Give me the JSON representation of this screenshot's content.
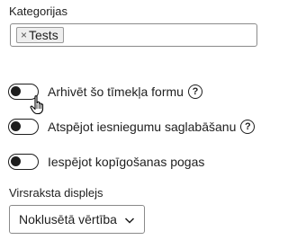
{
  "categories": {
    "label": "Kategorijas",
    "tags": [
      "Tests"
    ],
    "remove_symbol": "×"
  },
  "toggles": [
    {
      "label": "Arhivēt šo tīmekļa formu",
      "checked": false,
      "has_help": true
    },
    {
      "label": "Atspējot iesniegumu saglabāšanu",
      "checked": false,
      "has_help": true
    },
    {
      "label": "Iespējot kopīgošanas pogas",
      "checked": false,
      "has_help": false
    }
  ],
  "help_symbol": "?",
  "header_display": {
    "label": "Virsraksta displejs",
    "selected": "Noklusētā vērtība"
  },
  "icons": {
    "help": "question-circle-icon",
    "select": "chevron-down-icon",
    "cursor": "hand-pointer-cursor-icon"
  }
}
